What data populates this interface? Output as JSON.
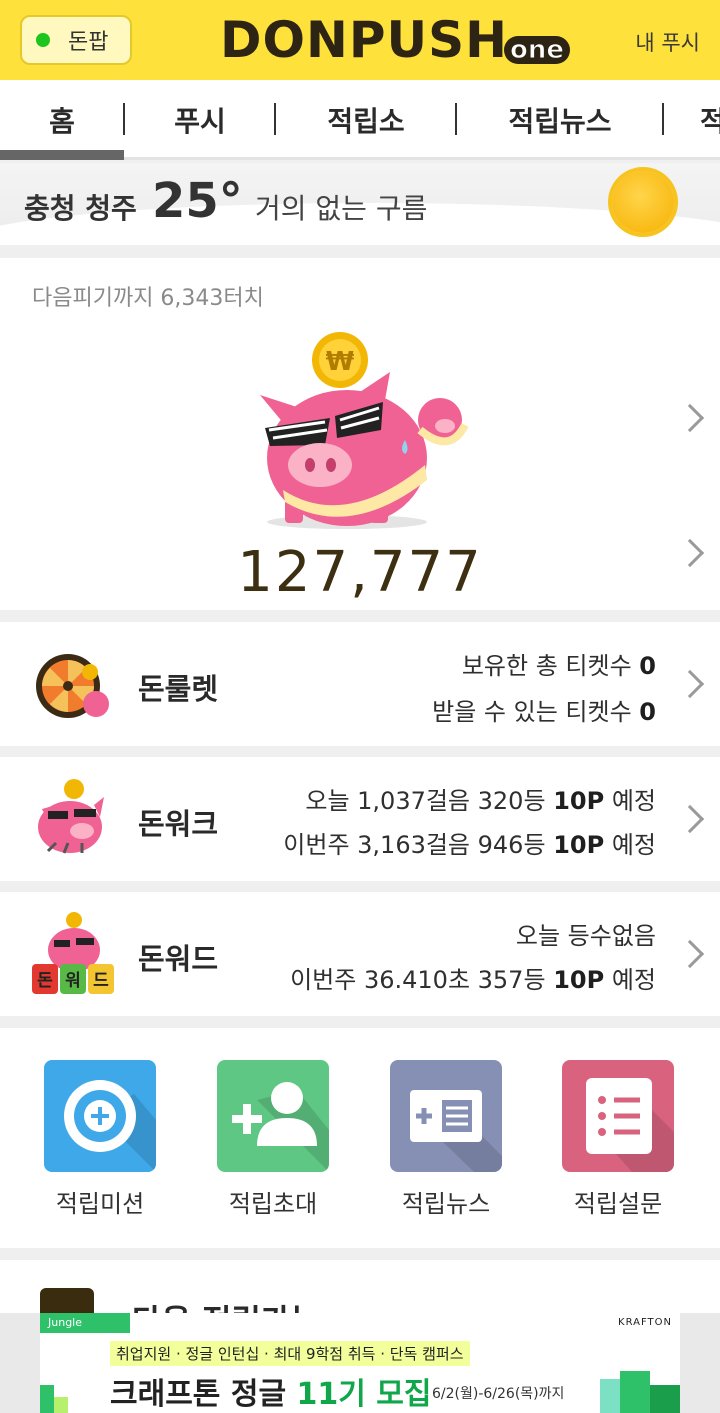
{
  "header": {
    "donpap_label": "돈팝",
    "logo_main": "DONPUSH",
    "logo_sub": "one",
    "my_push_label": "내 푸시"
  },
  "tabs": [
    {
      "label": "홈",
      "active": true
    },
    {
      "label": "푸시",
      "active": false
    },
    {
      "label": "적립소",
      "active": false
    },
    {
      "label": "적립뉴스",
      "active": false
    },
    {
      "label": "적",
      "active": false
    }
  ],
  "weather": {
    "city": "충청 청주",
    "temp": "25°",
    "description": "거의 없는 구름",
    "icon": "sun-icon"
  },
  "piggy": {
    "next_touch_text": "다음피기까지 6,343터치",
    "points": "127,777",
    "coin_symbol": "₩"
  },
  "games": [
    {
      "title": "돈룰렛",
      "line1": "보유한 총 티켓수",
      "line1_value": "0",
      "line2": "받을 수 있는 티켓수",
      "line2_value": "0"
    },
    {
      "title": "돈워크",
      "line1": "오늘 1,037걸음 320등",
      "line1_value": "10P",
      "line1_suffix": "예정",
      "line2": "이번주 3,163걸음 946등",
      "line2_value": "10P",
      "line2_suffix": "예정"
    },
    {
      "title": "돈워드",
      "line1": "오늘 등수없음",
      "line2": "이번주 36.410초 357등",
      "line2_value": "10P",
      "line2_suffix": "예정",
      "tiles": [
        "돈",
        "워",
        "드"
      ]
    }
  ],
  "actions": [
    {
      "label": "적립미션",
      "icon": "plus-circle-icon",
      "color": "#3ea8e8"
    },
    {
      "label": "적립초대",
      "icon": "add-person-icon",
      "color": "#5fc784"
    },
    {
      "label": "적립뉴스",
      "icon": "news-card-icon",
      "color": "#8690b5"
    },
    {
      "label": "적립설문",
      "icon": "survey-list-icon",
      "color": "#d9637f"
    }
  ],
  "teaser": {
    "text": "다음 적립가능"
  },
  "ad": {
    "brand": "Jungle",
    "sponsor": "KRAFTON",
    "info": "취업지원 · 정글 인턴십 · 최대 9학점 취득 · 단독 캠퍼스",
    "title_prefix": "크래프톤 정글",
    "title_accent": "11기 모집",
    "date": "6/2(월)-6/26(목)까지"
  },
  "colors": {
    "header_yellow": "#ffe13c",
    "pig_pink": "#f06293",
    "point_brown": "#3c2f12"
  }
}
